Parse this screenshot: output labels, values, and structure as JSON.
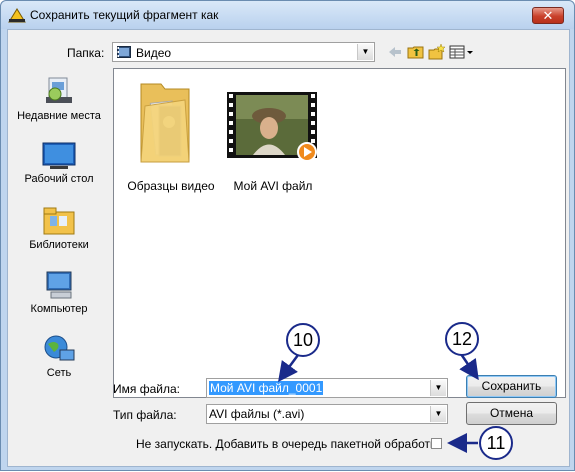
{
  "window": {
    "title": "Сохранить текущий фрагмент как",
    "close_symbol": "✕"
  },
  "toolbar": {
    "folder_label": "Папка:",
    "folder_value": "Видео",
    "icons": [
      "back-arrow-icon",
      "up-folder-icon",
      "new-folder-icon",
      "view-menu-icon"
    ]
  },
  "places": [
    {
      "name": "recent-places",
      "label": "Недавние места",
      "icon": "recent-places-icon"
    },
    {
      "name": "desktop",
      "label": "Рабочий стол",
      "icon": "desktop-icon"
    },
    {
      "name": "libraries",
      "label": "Библиотеки",
      "icon": "libraries-icon"
    },
    {
      "name": "computer",
      "label": "Компьютер",
      "icon": "computer-icon"
    },
    {
      "name": "network",
      "label": "Сеть",
      "icon": "network-icon"
    }
  ],
  "files": [
    {
      "label": "Образцы видео",
      "type": "folder"
    },
    {
      "label": "Мой AVI файл",
      "type": "video"
    }
  ],
  "filename": {
    "label": "Имя файла:",
    "value": "Мой AVI файл_0001"
  },
  "filetype": {
    "label": "Тип файла:",
    "value": "AVI файлы (*.avi)"
  },
  "buttons": {
    "save": "Сохранить",
    "cancel": "Отмена"
  },
  "batch": {
    "label": "Не запускать. Добавить в очередь пакетной обработки",
    "checked": false
  },
  "callouts": [
    "10",
    "12",
    "11"
  ],
  "colors": {
    "callout_border": "#1a2a8a",
    "selection": "#3399ff",
    "close_button": "#c9412b"
  }
}
